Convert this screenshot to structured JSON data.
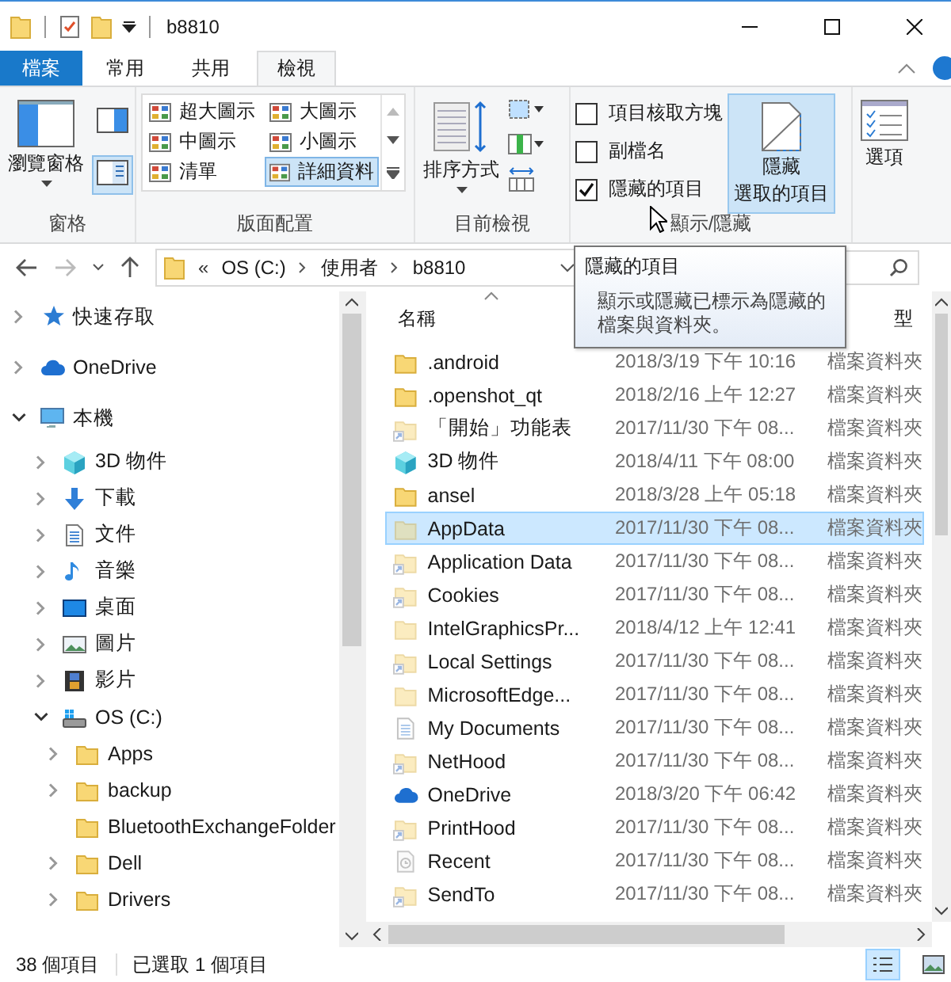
{
  "window": {
    "title": "b8810"
  },
  "ribbon": {
    "tabs": [
      {
        "label": "檔案",
        "kind": "file",
        "selected": false
      },
      {
        "label": "常用",
        "kind": "tab",
        "selected": false
      },
      {
        "label": "共用",
        "kind": "tab",
        "selected": false
      },
      {
        "label": "檢視",
        "kind": "tab",
        "selected": true
      }
    ],
    "panes": {
      "label": "瀏覽窗格",
      "caption": "窗格",
      "side_buttons": [
        {
          "kind": "preview",
          "selected": false
        },
        {
          "kind": "details",
          "selected": true
        }
      ]
    },
    "layout": {
      "caption": "版面配置",
      "options": [
        {
          "label": "超大圖示",
          "selected": false
        },
        {
          "label": "大圖示",
          "selected": false
        },
        {
          "label": "中圖示",
          "selected": false
        },
        {
          "label": "小圖示",
          "selected": false
        },
        {
          "label": "清單",
          "selected": false
        },
        {
          "label": "詳細資料",
          "selected": true
        }
      ]
    },
    "current_view": {
      "sort_label": "排序方式",
      "caption": "目前檢視"
    },
    "show_hide": {
      "caption": "顯示/隱藏",
      "checkboxes": [
        {
          "label": "項目核取方塊",
          "checked": false
        },
        {
          "label": "副檔名",
          "checked": false
        },
        {
          "label": "隱藏的項目",
          "checked": true
        }
      ],
      "hide_selected": {
        "lines": [
          "隱藏",
          "選取的項目"
        ],
        "selected": true
      }
    },
    "options": {
      "label": "選項"
    }
  },
  "address": {
    "overflow_mark": "«",
    "segments": [
      "OS (C:)",
      "使用者",
      "b8810"
    ]
  },
  "tooltip": {
    "title": "隱藏的項目",
    "text": "顯示或隱藏已標示為隱藏的檔案與資料夾。"
  },
  "tree": [
    {
      "label": "快速存取",
      "kind": "star",
      "expandable": true,
      "expanded": false
    },
    {
      "label": "OneDrive",
      "kind": "cloud",
      "expandable": true,
      "expanded": false
    },
    {
      "label": "本機",
      "kind": "pc",
      "expandable": true,
      "expanded": true,
      "children": [
        {
          "label": "3D 物件",
          "kind": "cube",
          "expandable": true,
          "expanded": false
        },
        {
          "label": "下載",
          "kind": "download",
          "expandable": true,
          "expanded": false
        },
        {
          "label": "文件",
          "kind": "doc",
          "expandable": true,
          "expanded": false
        },
        {
          "label": "音樂",
          "kind": "music",
          "expandable": true,
          "expanded": false
        },
        {
          "label": "桌面",
          "kind": "desktop",
          "expandable": true,
          "expanded": false
        },
        {
          "label": "圖片",
          "kind": "picture",
          "expandable": true,
          "expanded": false
        },
        {
          "label": "影片",
          "kind": "video",
          "expandable": true,
          "expanded": false
        },
        {
          "label": "OS (C:)",
          "kind": "drive",
          "expandable": true,
          "expanded": true,
          "children": [
            {
              "label": "Apps",
              "kind": "folder",
              "expandable": true,
              "expanded": false
            },
            {
              "label": "backup",
              "kind": "folder",
              "expandable": true,
              "expanded": false
            },
            {
              "label": "BluetoothExchangeFolder",
              "kind": "folder",
              "expandable": false,
              "expanded": false
            },
            {
              "label": "Dell",
              "kind": "folder",
              "expandable": true,
              "expanded": false
            },
            {
              "label": "Drivers",
              "kind": "folder",
              "expandable": true,
              "expanded": false
            }
          ]
        }
      ]
    }
  ],
  "list": {
    "columns": [
      "名稱",
      "型"
    ],
    "rows": [
      {
        "name": ".android",
        "date": "2018/3/19 下午 10:16",
        "type": "檔案資料夾",
        "kind": "folder",
        "hidden": false,
        "selected": false
      },
      {
        "name": ".openshot_qt",
        "date": "2018/2/16 上午 12:27",
        "type": "檔案資料夾",
        "kind": "folder",
        "hidden": false,
        "selected": false
      },
      {
        "name": "「開始」功能表",
        "date": "2017/11/30 下午 08...",
        "type": "檔案資料夾",
        "kind": "shortcut",
        "hidden": true,
        "selected": false
      },
      {
        "name": "3D 物件",
        "date": "2018/4/11 下午 08:00",
        "type": "檔案資料夾",
        "kind": "cube",
        "hidden": false,
        "selected": false
      },
      {
        "name": "ansel",
        "date": "2018/3/28 上午 05:18",
        "type": "檔案資料夾",
        "kind": "folder",
        "hidden": false,
        "selected": false
      },
      {
        "name": "AppData",
        "date": "2017/11/30 下午 08...",
        "type": "檔案資料夾",
        "kind": "folder",
        "hidden": true,
        "selected": true
      },
      {
        "name": "Application Data",
        "date": "2017/11/30 下午 08...",
        "type": "檔案資料夾",
        "kind": "shortcut",
        "hidden": true,
        "selected": false
      },
      {
        "name": "Cookies",
        "date": "2017/11/30 下午 08...",
        "type": "檔案資料夾",
        "kind": "shortcut",
        "hidden": true,
        "selected": false
      },
      {
        "name": "IntelGraphicsPr...",
        "date": "2018/4/12 上午 12:41",
        "type": "檔案資料夾",
        "kind": "folder",
        "hidden": true,
        "selected": false
      },
      {
        "name": "Local Settings",
        "date": "2017/11/30 下午 08...",
        "type": "檔案資料夾",
        "kind": "shortcut",
        "hidden": true,
        "selected": false
      },
      {
        "name": "MicrosoftEdge...",
        "date": "2017/11/30 下午 08...",
        "type": "檔案資料夾",
        "kind": "folder",
        "hidden": true,
        "selected": false
      },
      {
        "name": "My Documents",
        "date": "2017/11/30 下午 08...",
        "type": "檔案資料夾",
        "kind": "doc",
        "hidden": true,
        "selected": false
      },
      {
        "name": "NetHood",
        "date": "2017/11/30 下午 08...",
        "type": "檔案資料夾",
        "kind": "shortcut",
        "hidden": true,
        "selected": false
      },
      {
        "name": "OneDrive",
        "date": "2018/3/20 下午 06:42",
        "type": "檔案資料夾",
        "kind": "cloud",
        "hidden": false,
        "selected": false
      },
      {
        "name": "PrintHood",
        "date": "2017/11/30 下午 08...",
        "type": "檔案資料夾",
        "kind": "shortcut",
        "hidden": true,
        "selected": false
      },
      {
        "name": "Recent",
        "date": "2017/11/30 下午 08...",
        "type": "檔案資料夾",
        "kind": "recent",
        "hidden": true,
        "selected": false
      },
      {
        "name": "SendTo",
        "date": "2017/11/30 下午 08...",
        "type": "檔案資料夾",
        "kind": "shortcut",
        "hidden": true,
        "selected": false
      }
    ]
  },
  "status_bar": {
    "count": "38 個項目",
    "selection": "已選取 1 個項目",
    "views": [
      {
        "kind": "details",
        "selected": true
      },
      {
        "kind": "large",
        "selected": false
      }
    ]
  }
}
